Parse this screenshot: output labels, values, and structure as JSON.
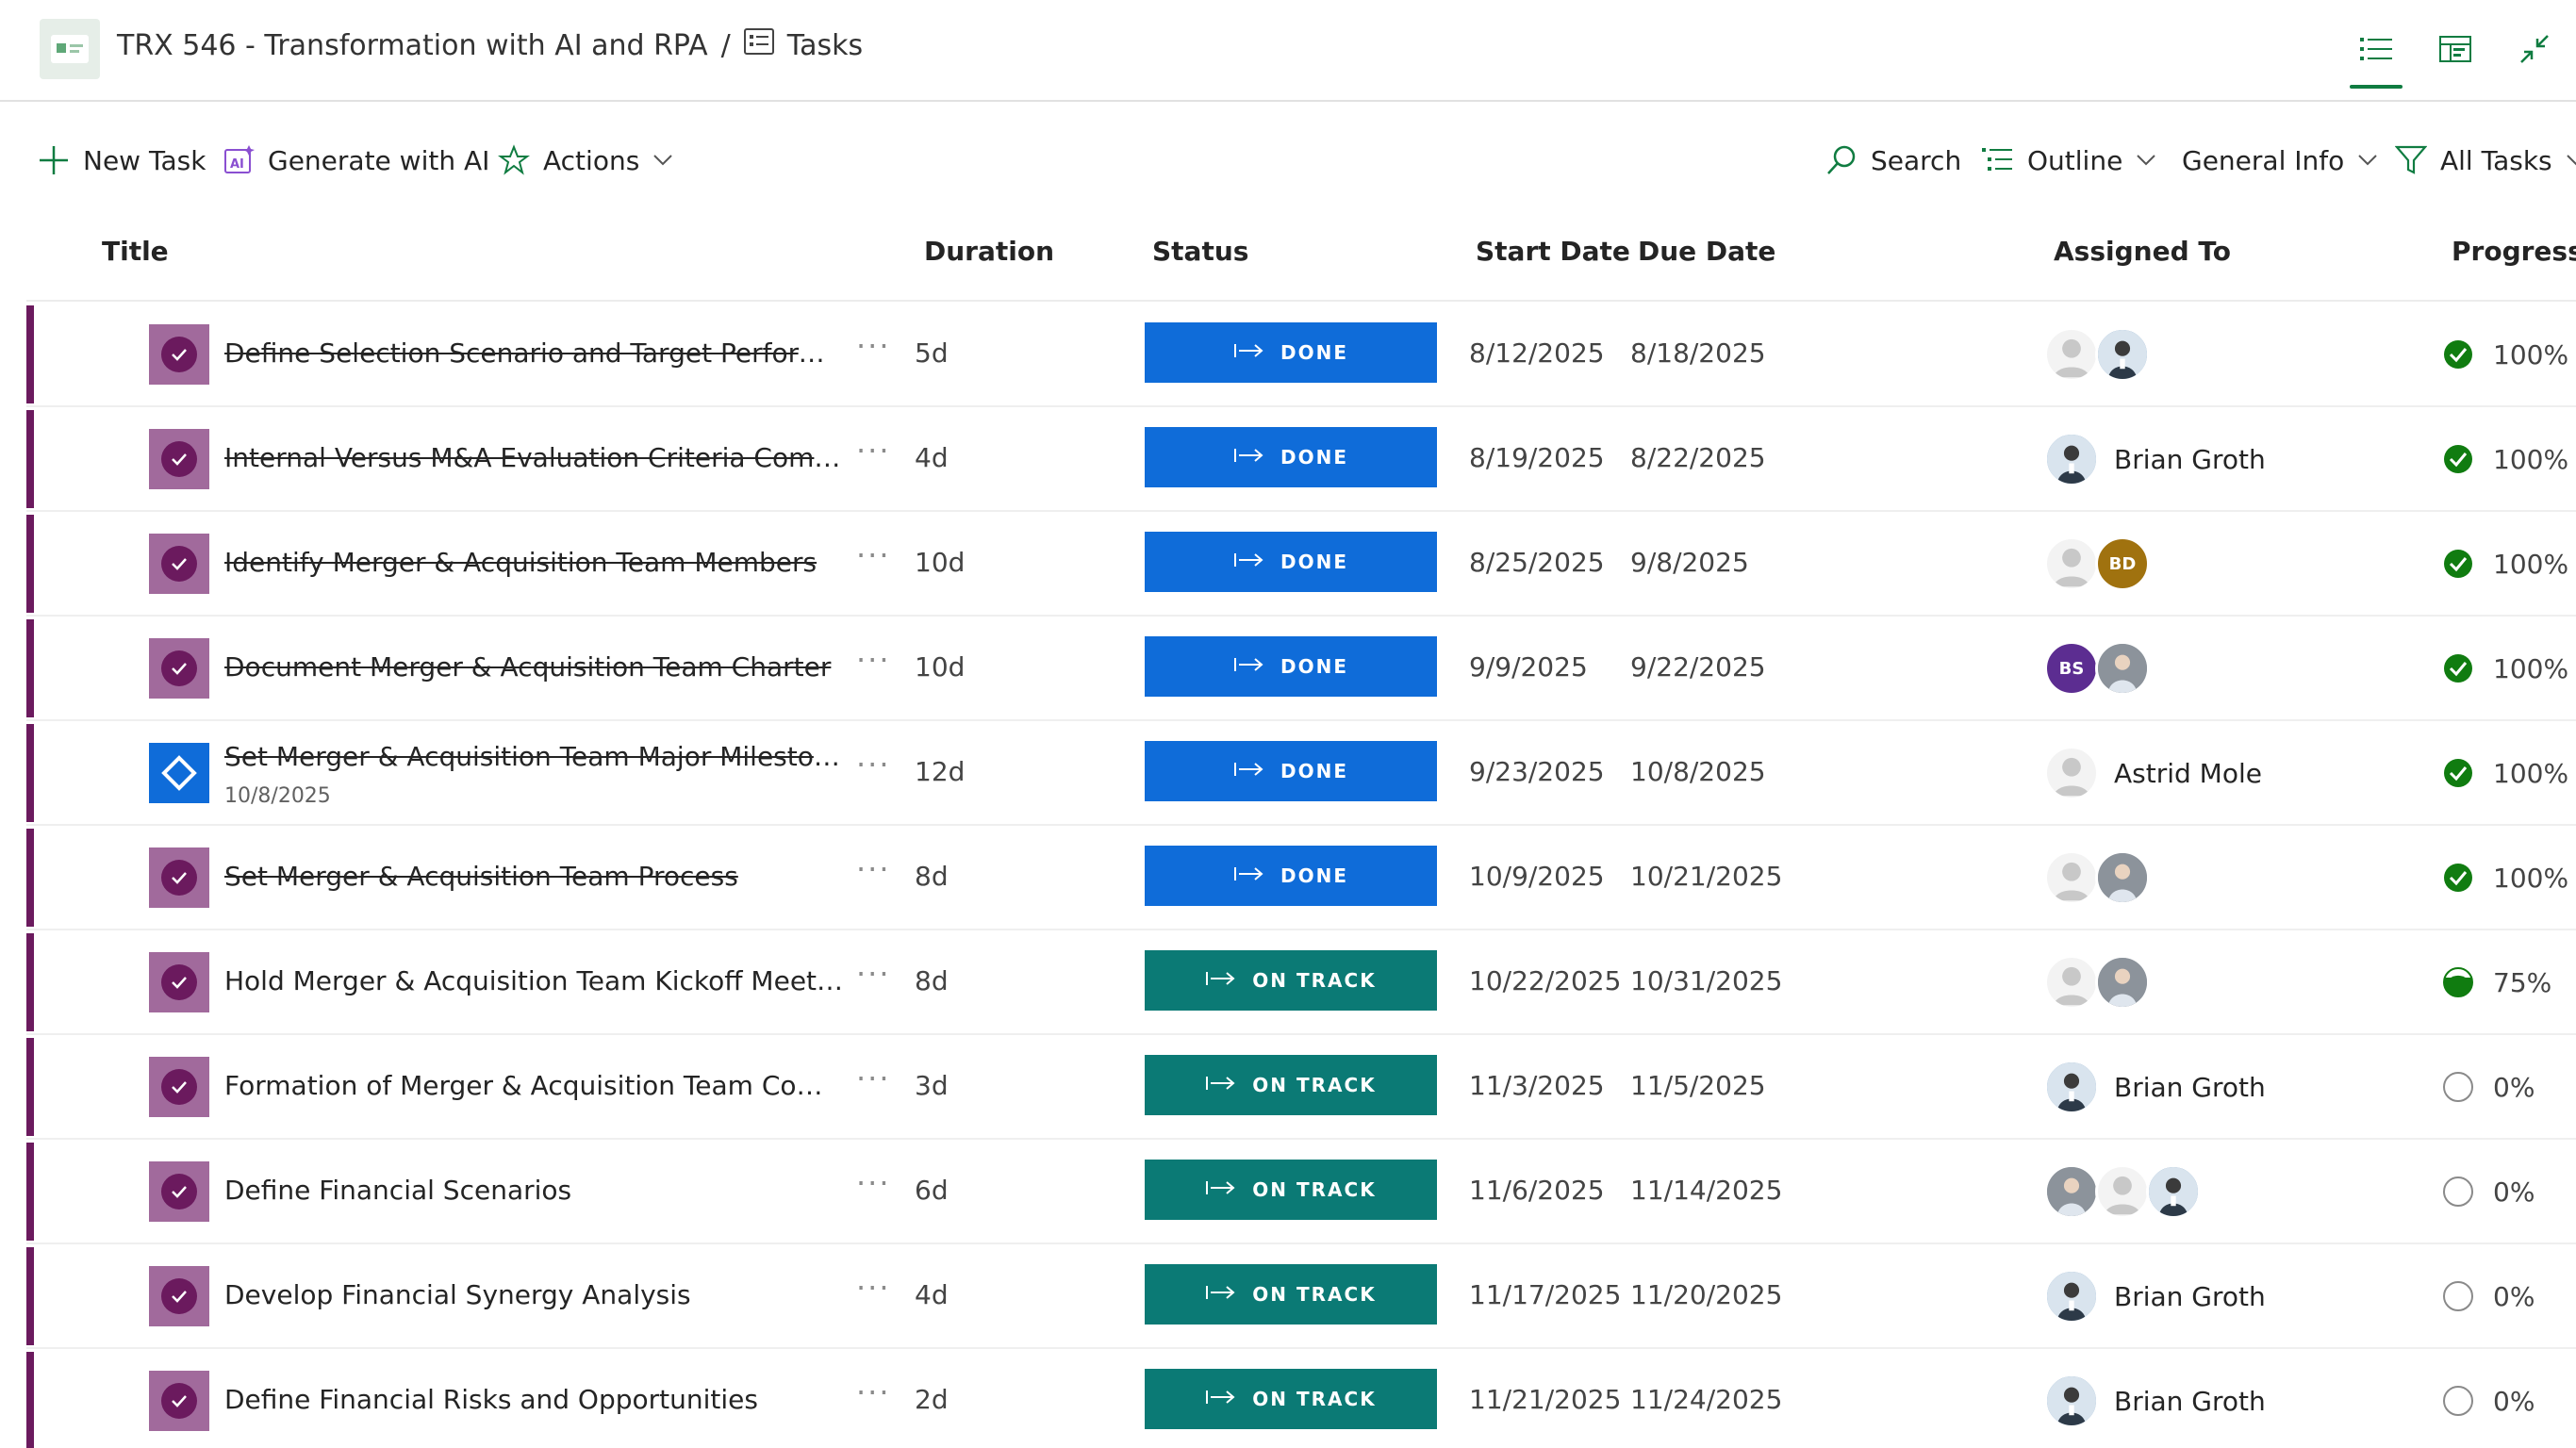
{
  "header": {
    "project": "TRX 546 - Transformation with AI and RPA",
    "separator": "/",
    "page": "Tasks"
  },
  "toolbar": {
    "new_task": "New Task",
    "generate_ai": "Generate with AI",
    "actions": "Actions",
    "search": "Search",
    "outline": "Outline",
    "general_info": "General Info",
    "all_tasks": "All Tasks"
  },
  "columns": {
    "title": "Title",
    "duration": "Duration",
    "status": "Status",
    "start": "Start Date",
    "due": "Due Date",
    "assigned": "Assigned To",
    "progress": "Progress, %"
  },
  "colors": {
    "done": "#0f6cd9",
    "on_track": "#0b7a75",
    "accent": "#107c41",
    "stripe": "#6b1a5e"
  },
  "rows": [
    {
      "title": "Define Selection Scenario and Target Performan...",
      "done": true,
      "duration": "5d",
      "status": "DONE",
      "start": "8/12/2025",
      "due": "8/18/2025",
      "avatars": [
        "gray",
        "photo"
      ],
      "name": "",
      "progress": "100%",
      "pct": 1.0
    },
    {
      "title": "Internal Versus M&A Evaluation Criteria Complete",
      "done": true,
      "duration": "4d",
      "status": "DONE",
      "start": "8/19/2025",
      "due": "8/22/2025",
      "avatars": [
        "photo"
      ],
      "name": "Brian Groth",
      "progress": "100%",
      "pct": 1.0
    },
    {
      "title": "Identify Merger & Acquisition Team Members",
      "done": true,
      "duration": "10d",
      "status": "DONE",
      "start": "8/25/2025",
      "due": "9/8/2025",
      "avatars": [
        "gray",
        "BD"
      ],
      "name": "",
      "progress": "100%",
      "pct": 1.0
    },
    {
      "title": "Document Merger & Acquisition Team Charter",
      "done": true,
      "duration": "10d",
      "status": "DONE",
      "start": "9/9/2025",
      "due": "9/22/2025",
      "avatars": [
        "BS",
        "photo2"
      ],
      "name": "",
      "progress": "100%",
      "pct": 1.0
    },
    {
      "title": "Set Merger & Acquisition Team Major Milestones",
      "subtitle": "10/8/2025",
      "milestone": true,
      "done": true,
      "duration": "12d",
      "status": "DONE",
      "start": "9/23/2025",
      "due": "10/8/2025",
      "avatars": [
        "gray"
      ],
      "name": "Astrid Mole",
      "progress": "100%",
      "pct": 1.0
    },
    {
      "title": "Set Merger & Acquisition Team Process",
      "done": true,
      "duration": "8d",
      "status": "DONE",
      "start": "10/9/2025",
      "due": "10/21/2025",
      "avatars": [
        "gray",
        "photo2"
      ],
      "name": "",
      "progress": "100%",
      "pct": 1.0
    },
    {
      "title": "Hold Merger & Acquisition Team Kickoff Meeting",
      "done": false,
      "duration": "8d",
      "status": "ON TRACK",
      "start": "10/22/2025",
      "due": "10/31/2025",
      "avatars": [
        "gray",
        "photo2"
      ],
      "name": "",
      "progress": "75%",
      "pct": 0.75
    },
    {
      "title": "Formation of Merger & Acquisition Team Comp...",
      "done": false,
      "duration": "3d",
      "status": "ON TRACK",
      "start": "11/3/2025",
      "due": "11/5/2025",
      "avatars": [
        "photo"
      ],
      "name": "Brian Groth",
      "progress": "0%",
      "pct": 0
    },
    {
      "title": "Define Financial Scenarios",
      "done": false,
      "duration": "6d",
      "status": "ON TRACK",
      "start": "11/6/2025",
      "due": "11/14/2025",
      "avatars": [
        "photo2",
        "gray",
        "photo"
      ],
      "name": "",
      "progress": "0%",
      "pct": 0
    },
    {
      "title": "Develop Financial Synergy Analysis",
      "done": false,
      "duration": "4d",
      "status": "ON TRACK",
      "start": "11/17/2025",
      "due": "11/20/2025",
      "avatars": [
        "photo"
      ],
      "name": "Brian Groth",
      "progress": "0%",
      "pct": 0
    },
    {
      "title": "Define Financial Risks and Opportunities",
      "done": false,
      "duration": "2d",
      "status": "ON TRACK",
      "start": "11/21/2025",
      "due": "11/24/2025",
      "avatars": [
        "photo"
      ],
      "name": "Brian Groth",
      "progress": "0%",
      "pct": 0
    }
  ]
}
